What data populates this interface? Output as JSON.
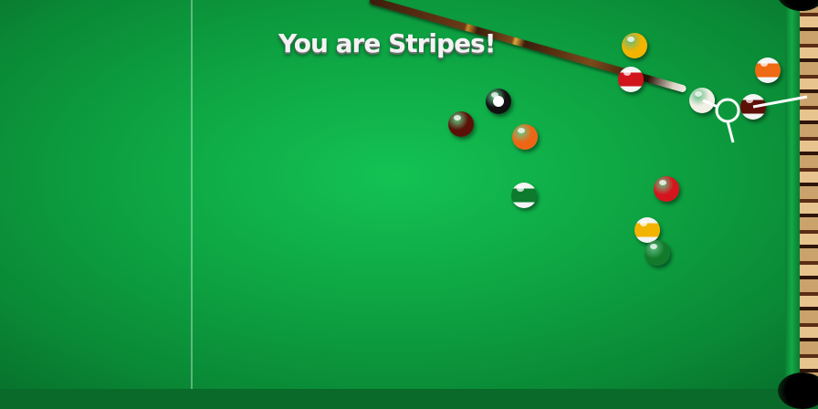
{
  "banner": {
    "text": "You are Stripes!"
  },
  "player_group": "Stripes",
  "balls": [
    {
      "id": "cue-ball",
      "kind": "cue",
      "color": "#f2f0e6"
    },
    {
      "id": "ball-8",
      "kind": "solid",
      "color": "#111111"
    },
    {
      "id": "ball-yellow-solid-1",
      "kind": "solid",
      "color": "#f2b400"
    },
    {
      "id": "ball-red-stripe-1",
      "kind": "stripe",
      "color": "#d1131c"
    },
    {
      "id": "ball-orange-stripe-1",
      "kind": "stripe",
      "color": "#ef6a12"
    },
    {
      "id": "ball-maroon-solid",
      "kind": "solid",
      "color": "#5a1208"
    },
    {
      "id": "ball-orange-solid",
      "kind": "solid",
      "color": "#ee6615"
    },
    {
      "id": "ball-green-stripe",
      "kind": "stripe",
      "color": "#0d7a2e"
    },
    {
      "id": "ball-red-solid",
      "kind": "solid",
      "color": "#d6141d"
    },
    {
      "id": "ball-yellow-stripe",
      "kind": "stripe",
      "color": "#f2b400"
    },
    {
      "id": "ball-green-solid",
      "kind": "solid",
      "color": "#137a2c"
    },
    {
      "id": "ball-maroon-stripe",
      "kind": "stripe",
      "color": "#5c1008"
    }
  ],
  "colors": {
    "felt": "#0ea644",
    "banner_text": "#f3f3f3",
    "aim_line": "#ffffff"
  }
}
